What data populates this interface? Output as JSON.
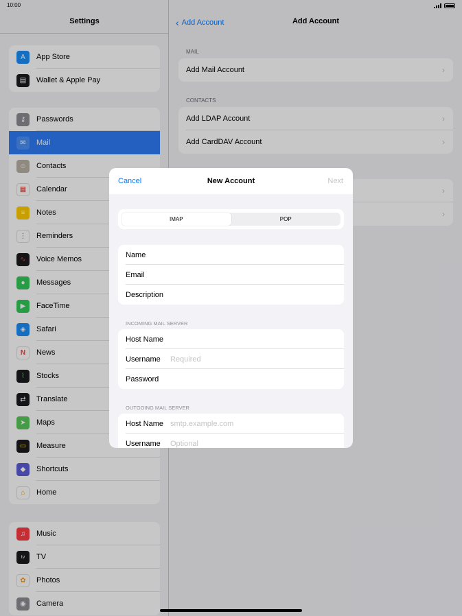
{
  "status": {
    "time": "10:00"
  },
  "sidebar": {
    "title": "Settings",
    "groups": [
      [
        {
          "label": "App Store",
          "icon": "app-store-icon",
          "color": "#1c8ef5"
        },
        {
          "label": "Wallet & Apple Pay",
          "icon": "wallet-icon",
          "color": "#1c1c1e"
        }
      ],
      [
        {
          "label": "Passwords",
          "icon": "key-icon",
          "color": "#8e8e93"
        },
        {
          "label": "Mail",
          "icon": "mail-icon",
          "color": "#2f7cf6"
        },
        {
          "label": "Contacts",
          "icon": "contacts-icon",
          "color": "#b8b0a5"
        },
        {
          "label": "Calendar",
          "icon": "calendar-icon",
          "color": "#ffffff"
        },
        {
          "label": "Notes",
          "icon": "notes-icon",
          "color": "#ffcc00"
        },
        {
          "label": "Reminders",
          "icon": "reminders-icon",
          "color": "#ffffff"
        },
        {
          "label": "Voice Memos",
          "icon": "voice-memos-icon",
          "color": "#1c1c1e"
        },
        {
          "label": "Messages",
          "icon": "messages-icon",
          "color": "#34c759"
        },
        {
          "label": "FaceTime",
          "icon": "facetime-icon",
          "color": "#34c759"
        },
        {
          "label": "Safari",
          "icon": "safari-icon",
          "color": "#1c8ef5"
        },
        {
          "label": "News",
          "icon": "news-icon",
          "color": "#ff3b30"
        },
        {
          "label": "Stocks",
          "icon": "stocks-icon",
          "color": "#1c1c1e"
        },
        {
          "label": "Translate",
          "icon": "translate-icon",
          "color": "#1c1c1e"
        },
        {
          "label": "Maps",
          "icon": "maps-icon",
          "color": "#5ac85a"
        },
        {
          "label": "Measure",
          "icon": "measure-icon",
          "color": "#1c1c1e"
        },
        {
          "label": "Shortcuts",
          "icon": "shortcuts-icon",
          "color": "#5b5bd6"
        },
        {
          "label": "Home",
          "icon": "home-icon",
          "color": "#ff9500"
        }
      ],
      [
        {
          "label": "Music",
          "icon": "music-icon",
          "color": "#fc3c44"
        },
        {
          "label": "TV",
          "icon": "tv-icon",
          "color": "#1c1c1e"
        },
        {
          "label": "Photos",
          "icon": "photos-icon",
          "color": "#ffffff"
        },
        {
          "label": "Camera",
          "icon": "camera-icon",
          "color": "#8e8e93"
        }
      ]
    ],
    "selected": "Mail"
  },
  "detail": {
    "back_label": "Add Account",
    "title": "Add Account",
    "sections": [
      {
        "header": "MAIL",
        "rows": [
          "Add Mail Account"
        ]
      },
      {
        "header": "CONTACTS",
        "rows": [
          "Add LDAP Account",
          "Add CardDAV Account"
        ]
      }
    ]
  },
  "modal": {
    "cancel": "Cancel",
    "title": "New Account",
    "next": "Next",
    "segments": [
      "IMAP",
      "POP"
    ],
    "selected_segment": "IMAP",
    "account_fields": [
      "Name",
      "Email",
      "Description"
    ],
    "incoming": {
      "header": "INCOMING MAIL SERVER",
      "host_label": "Host Name",
      "username_label": "Username",
      "username_placeholder": "Required",
      "password_label": "Password"
    },
    "outgoing": {
      "header": "OUTGOING MAIL SERVER",
      "host_label": "Host Name",
      "host_placeholder": "smtp.example.com",
      "username_label": "Username",
      "username_placeholder": "Optional"
    }
  }
}
